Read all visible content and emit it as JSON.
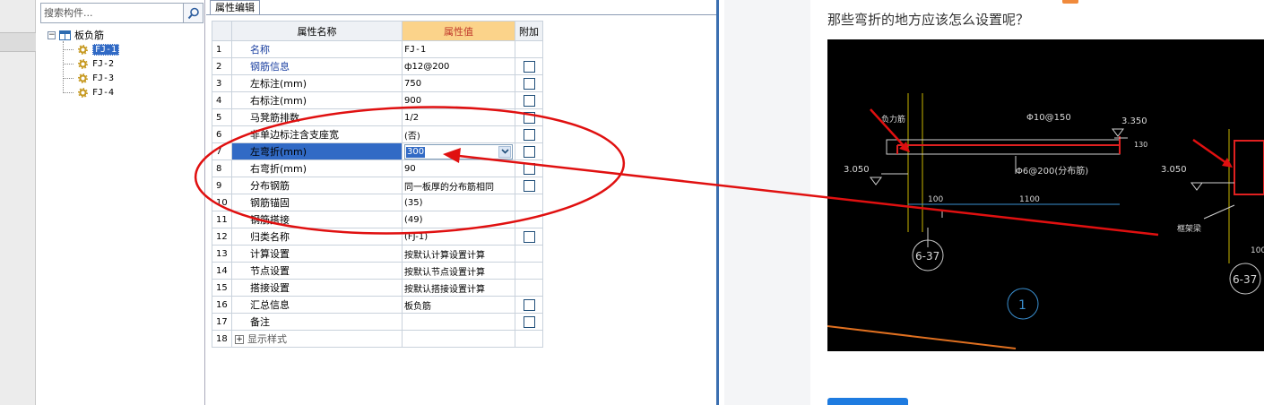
{
  "tree": {
    "search_placeholder": "搜索构件...",
    "root_label": "板负筋",
    "items": [
      "FJ-1",
      "FJ-2",
      "FJ-3",
      "FJ-4"
    ]
  },
  "prop": {
    "tab_label": "属性编辑",
    "headers": {
      "num": "",
      "name": "属性名称",
      "value": "属性值",
      "extra": "附加"
    },
    "rows": [
      {
        "n": "1",
        "name": "名称",
        "value": "FJ-1"
      },
      {
        "n": "2",
        "name": "钢筋信息",
        "value": "ф12@200"
      },
      {
        "n": "3",
        "name": "左标注(mm)",
        "value": "750"
      },
      {
        "n": "4",
        "name": "右标注(mm)",
        "value": "900"
      },
      {
        "n": "5",
        "name": "马凳筋排数",
        "value": "1/2"
      },
      {
        "n": "6",
        "name": "非单边标注含支座宽",
        "value": "(否)"
      },
      {
        "n": "7",
        "name": "左弯折(mm)",
        "value": "300"
      },
      {
        "n": "8",
        "name": "右弯折(mm)",
        "value": "90"
      },
      {
        "n": "9",
        "name": "分布钢筋",
        "value": "同一板厚的分布筋相同"
      },
      {
        "n": "10",
        "name": "钢筋锚固",
        "value": "(35)"
      },
      {
        "n": "11",
        "name": "钢筋搭接",
        "value": "(49)"
      },
      {
        "n": "12",
        "name": "归类名称",
        "value": "(FJ-1)"
      },
      {
        "n": "13",
        "name": "计算设置",
        "value": "按默认计算设置计算"
      },
      {
        "n": "14",
        "name": "节点设置",
        "value": "按默认节点设置计算"
      },
      {
        "n": "15",
        "name": "搭接设置",
        "value": "按默认搭接设置计算"
      },
      {
        "n": "16",
        "name": "汇总信息",
        "value": "板负筋"
      },
      {
        "n": "17",
        "name": "备注",
        "value": ""
      },
      {
        "n": "18",
        "name": "显示样式",
        "value": ""
      }
    ]
  },
  "question": "那些弯折的地方应该怎么设置呢？",
  "cad": {
    "labels": {
      "rebar_top": "Φ10@150",
      "rebar_dist": "Φ6@200(分布筋)",
      "elev_right": "3.350",
      "elev_left": "3.050",
      "elev_left2": "3.050",
      "dim_100": "100",
      "dim_1100": "1100",
      "dim_130": "130",
      "dim_100b": "100",
      "axis_a": "6-37",
      "axis_b": "6-37",
      "section": "1",
      "note_left": "负力筋",
      "note_right": "框架梁"
    }
  },
  "colors": {
    "selection": "#316ac5",
    "header_value_bg": "#fbd38a",
    "annotation": "#e01010"
  }
}
